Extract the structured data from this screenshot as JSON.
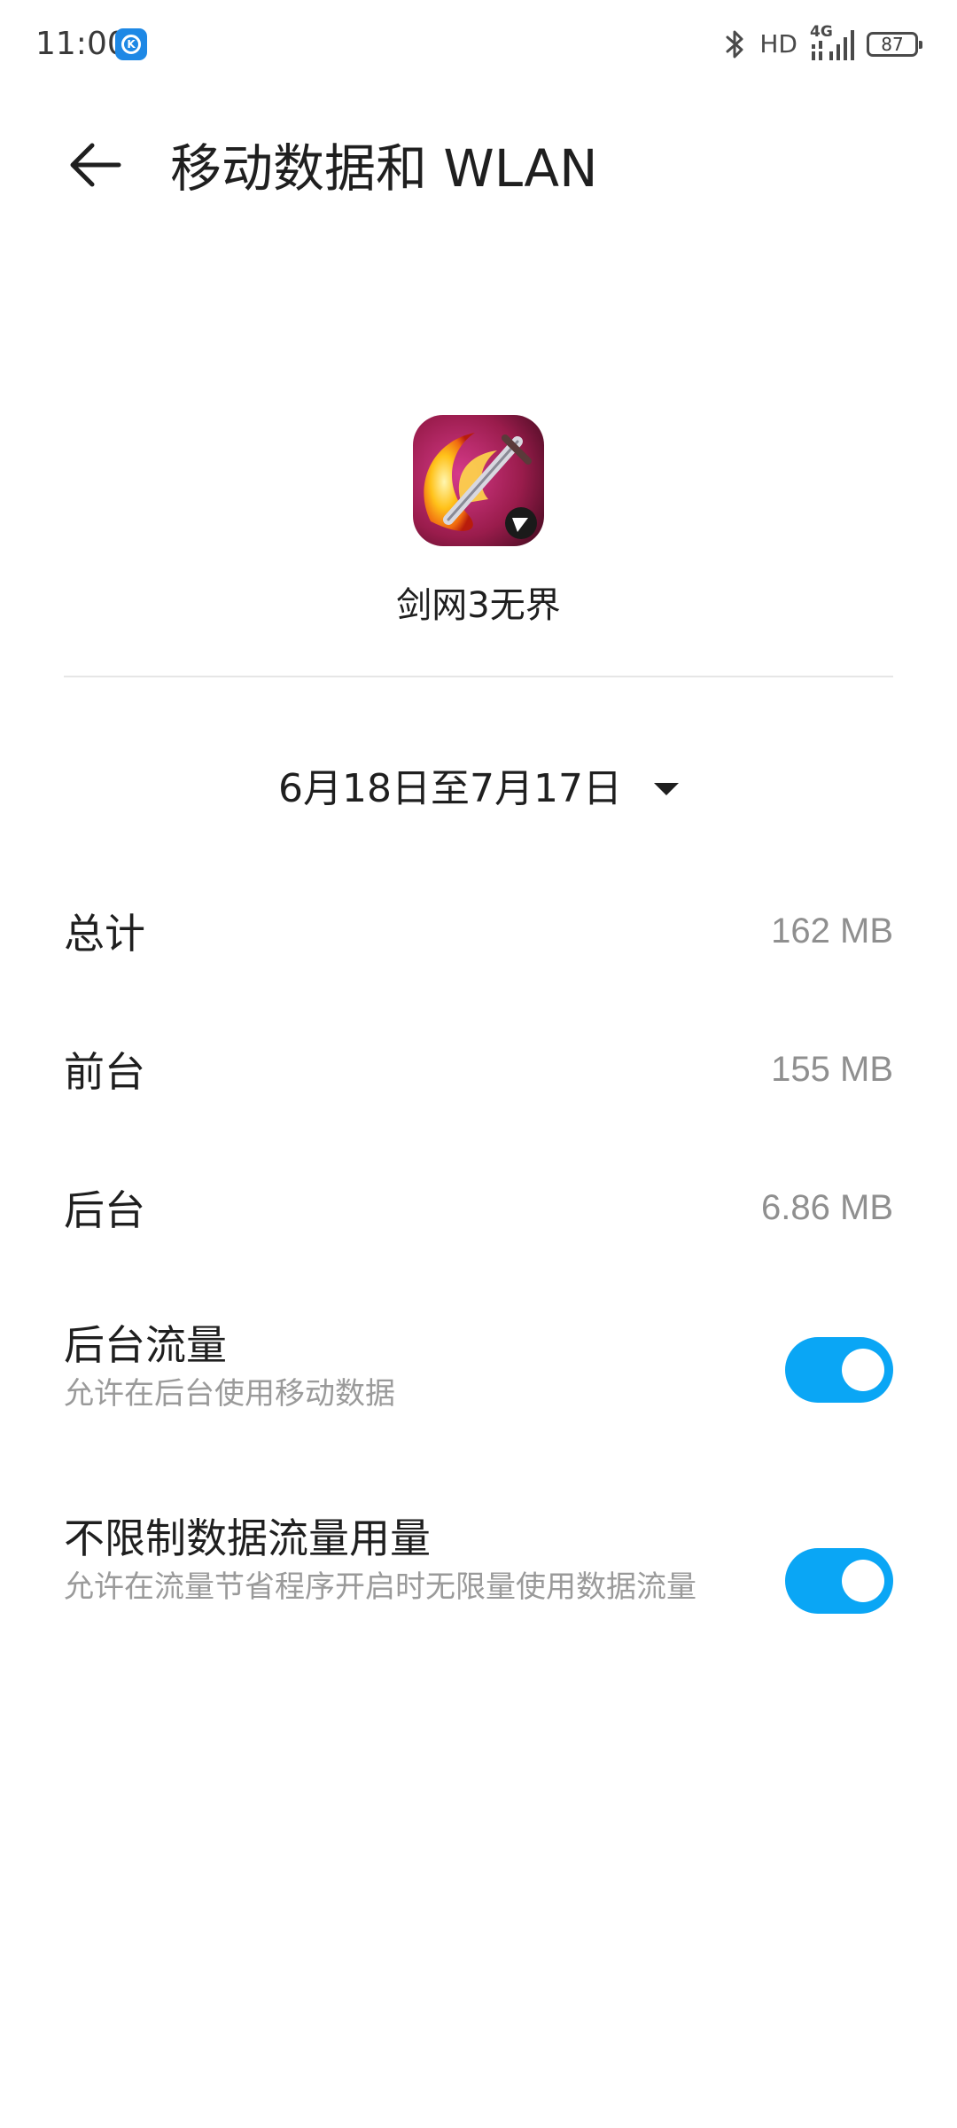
{
  "status_bar": {
    "time": "11:00",
    "network_label": "HD",
    "signal_label": "4G",
    "battery": "87"
  },
  "header": {
    "title": "移动数据和 WLAN"
  },
  "app": {
    "name": "剑网3无界"
  },
  "period": {
    "label": "6月18日至7月17日"
  },
  "usage": [
    {
      "label": "总计",
      "value": "162 MB"
    },
    {
      "label": "前台",
      "value": "155 MB"
    },
    {
      "label": "后台",
      "value": "6.86 MB"
    }
  ],
  "settings": [
    {
      "title": "后台流量",
      "description": "允许在后台使用移动数据",
      "enabled": true
    },
    {
      "title": "不限制数据流量用量",
      "description": "允许在流量节省程序开启时无限量使用数据流量",
      "enabled": true
    }
  ],
  "colors": {
    "accent": "#0aa6f5",
    "secondary_text": "#8f8f8f"
  }
}
